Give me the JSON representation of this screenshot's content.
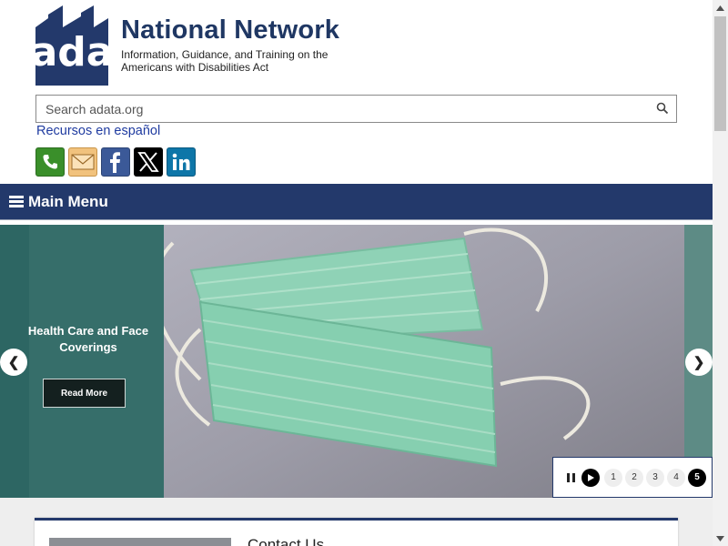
{
  "header": {
    "logo_text": "ada",
    "title": "National Network",
    "tagline": "Information, Guidance, and Training on the Americans with Disabilities Act"
  },
  "search": {
    "placeholder": "Search adata.org"
  },
  "spanish_link": "Recursos en español",
  "social": [
    {
      "name": "phone-icon"
    },
    {
      "name": "email-icon"
    },
    {
      "name": "facebook-icon"
    },
    {
      "name": "x-icon"
    },
    {
      "name": "linkedin-icon"
    }
  ],
  "main_menu": {
    "label": "Main Menu"
  },
  "slider": {
    "caption": "Health Care and Face Coverings",
    "button_label": "Read More",
    "prev": "❮",
    "next": "❯",
    "pages": [
      "1",
      "2",
      "3",
      "4",
      "5"
    ],
    "active_page": "5"
  },
  "card": {
    "title": "Contact Us"
  },
  "colors": {
    "brand_navy": "#23396b",
    "slide_teal": "#2f6a67"
  }
}
